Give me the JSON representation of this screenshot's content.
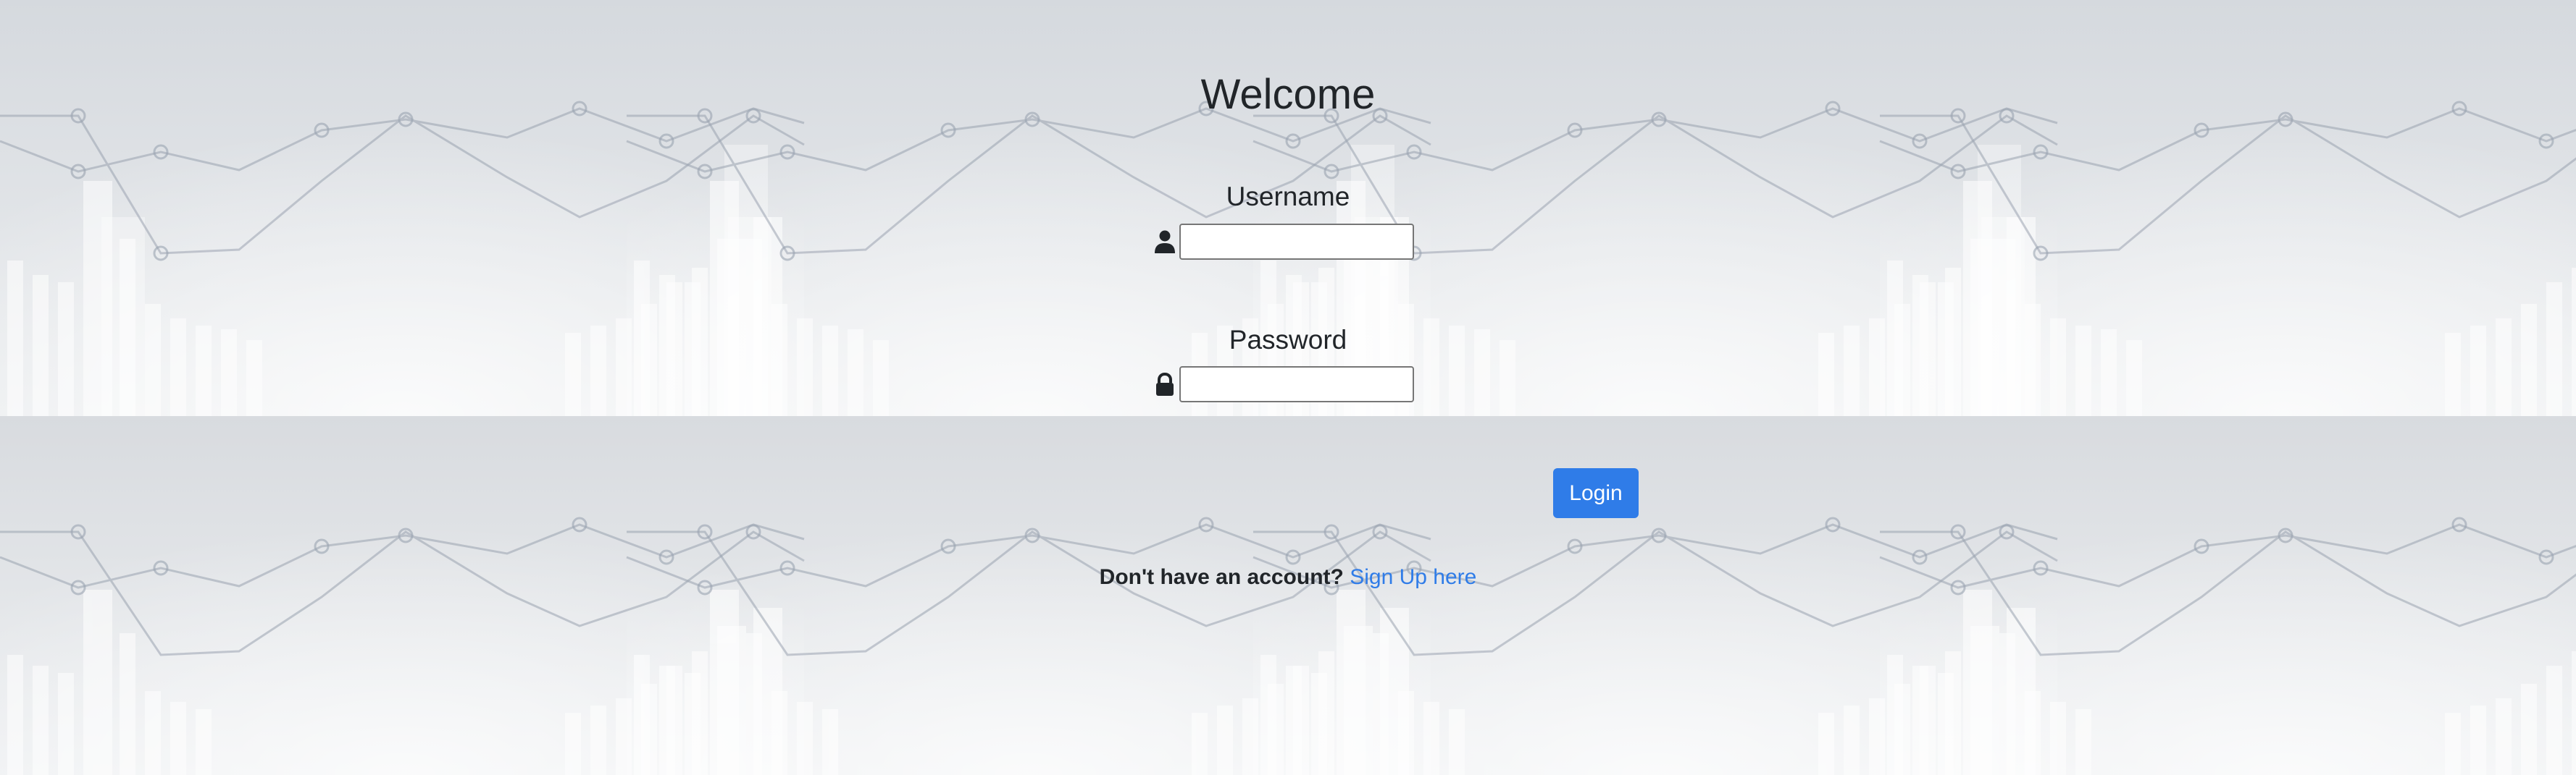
{
  "page": {
    "title": "Welcome"
  },
  "form": {
    "username_label": "Username",
    "username_value": "",
    "password_label": "Password",
    "password_value": "",
    "login_label": "Login"
  },
  "signup": {
    "prompt": "Don't have an account?",
    "link_label": "Sign Up here"
  },
  "icons": {
    "username": "user-icon",
    "password": "lock-icon"
  },
  "colors": {
    "accent": "#2f7ce8",
    "text": "#212529",
    "background": "#dfe2e6"
  }
}
